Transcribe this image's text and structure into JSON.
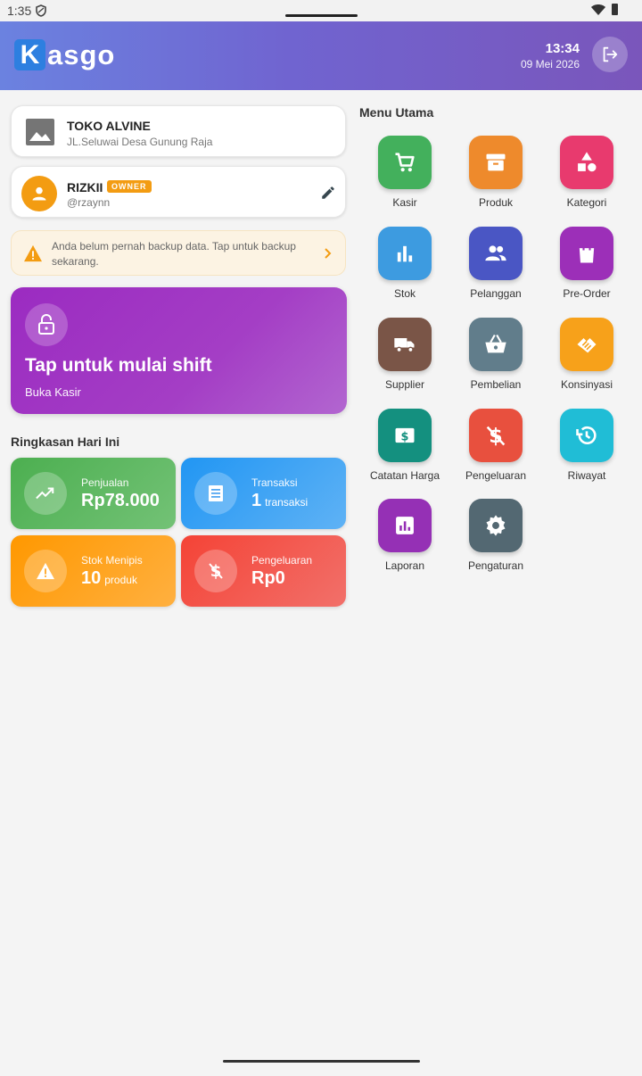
{
  "status_bar": {
    "time": "1:35"
  },
  "header": {
    "logo_k": "K",
    "logo_rest": "asgo",
    "time": "13:34",
    "date": "09 Mei 2026"
  },
  "store": {
    "name": "TOKO ALVINE",
    "address": "JL.Seluwai Desa Gunung Raja"
  },
  "user": {
    "name": "RIZKII",
    "role": "OWNER",
    "handle": "@rzaynn"
  },
  "backup_notice": {
    "text": "Anda belum pernah backup data. Tap untuk backup sekarang."
  },
  "shift": {
    "title": "Tap untuk mulai shift",
    "subtitle": "Buka Kasir"
  },
  "summary": {
    "title": "Ringkasan Hari Ini",
    "sales": {
      "label": "Penjualan",
      "value": "Rp78.000"
    },
    "transactions": {
      "label": "Transaksi",
      "value": "1",
      "unit": "transaksi"
    },
    "low_stock": {
      "label": "Stok Menipis",
      "value": "10",
      "unit": "produk"
    },
    "expenses": {
      "label": "Pengeluaran",
      "value": "Rp0"
    }
  },
  "menu": {
    "title": "Menu Utama",
    "items": [
      {
        "label": "Kasir",
        "icon": "cart-icon",
        "color": "#43b05c"
      },
      {
        "label": "Produk",
        "icon": "archive-icon",
        "color": "#ee8a2c"
      },
      {
        "label": "Kategori",
        "icon": "shapes-icon",
        "color": "#e83a6e"
      },
      {
        "label": "Stok",
        "icon": "bar-chart-icon",
        "color": "#3d9be0"
      },
      {
        "label": "Pelanggan",
        "icon": "people-icon",
        "color": "#4a56c4"
      },
      {
        "label": "Pre-Order",
        "icon": "shopping-bag-icon",
        "color": "#9c2fb8"
      },
      {
        "label": "Supplier",
        "icon": "truck-icon",
        "color": "#7a5547"
      },
      {
        "label": "Pembelian",
        "icon": "basket-icon",
        "color": "#617d8b"
      },
      {
        "label": "Konsinyasi",
        "icon": "handshake-icon",
        "color": "#f7a11a"
      },
      {
        "label": "Catatan Harga",
        "icon": "price-tag-icon",
        "color": "#14907f"
      },
      {
        "label": "Pengeluaran",
        "icon": "money-off-icon",
        "color": "#e8503e"
      },
      {
        "label": "Riwayat",
        "icon": "history-icon",
        "color": "#20bdd6"
      },
      {
        "label": "Laporan",
        "icon": "report-icon",
        "color": "#9530b5"
      },
      {
        "label": "Pengaturan",
        "icon": "gear-icon",
        "color": "#536872"
      }
    ]
  }
}
